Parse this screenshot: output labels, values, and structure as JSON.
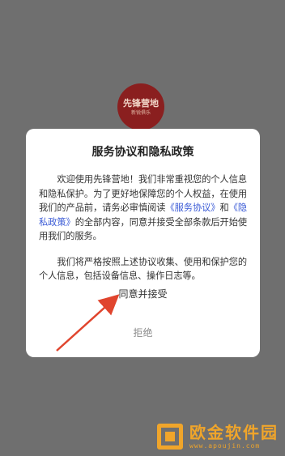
{
  "logo": {
    "title": "先锋营地",
    "subtitle": "新锐俱乐",
    "color": "#8a1f1f"
  },
  "dialog": {
    "title": "服务协议和隐私政策",
    "para1": {
      "before": "欢迎使用先锋营地！我们非常重视您的个人信息和隐私保护。为了更好地保障您的个人权益，在使用我们的产品前，请务必审慎阅读",
      "link1": "《服务协议》",
      "and": "和",
      "link2": "《隐私政策》",
      "after": "的全部内容，同意并接受全部条款后开始使用我们的服务。"
    },
    "para2": "我们将严格按照上述协议收集、使用和保护您的个人信息，包括设备信息、操作日志等。",
    "agree_label": "同意并接受",
    "reject_label": "拒绝",
    "link_color": "#3b5bd6"
  },
  "annotation": {
    "color": "#e0452e"
  },
  "watermark": {
    "name": "欧金软件园",
    "url": "www.apoujin.com",
    "color": "#f0a52a"
  }
}
